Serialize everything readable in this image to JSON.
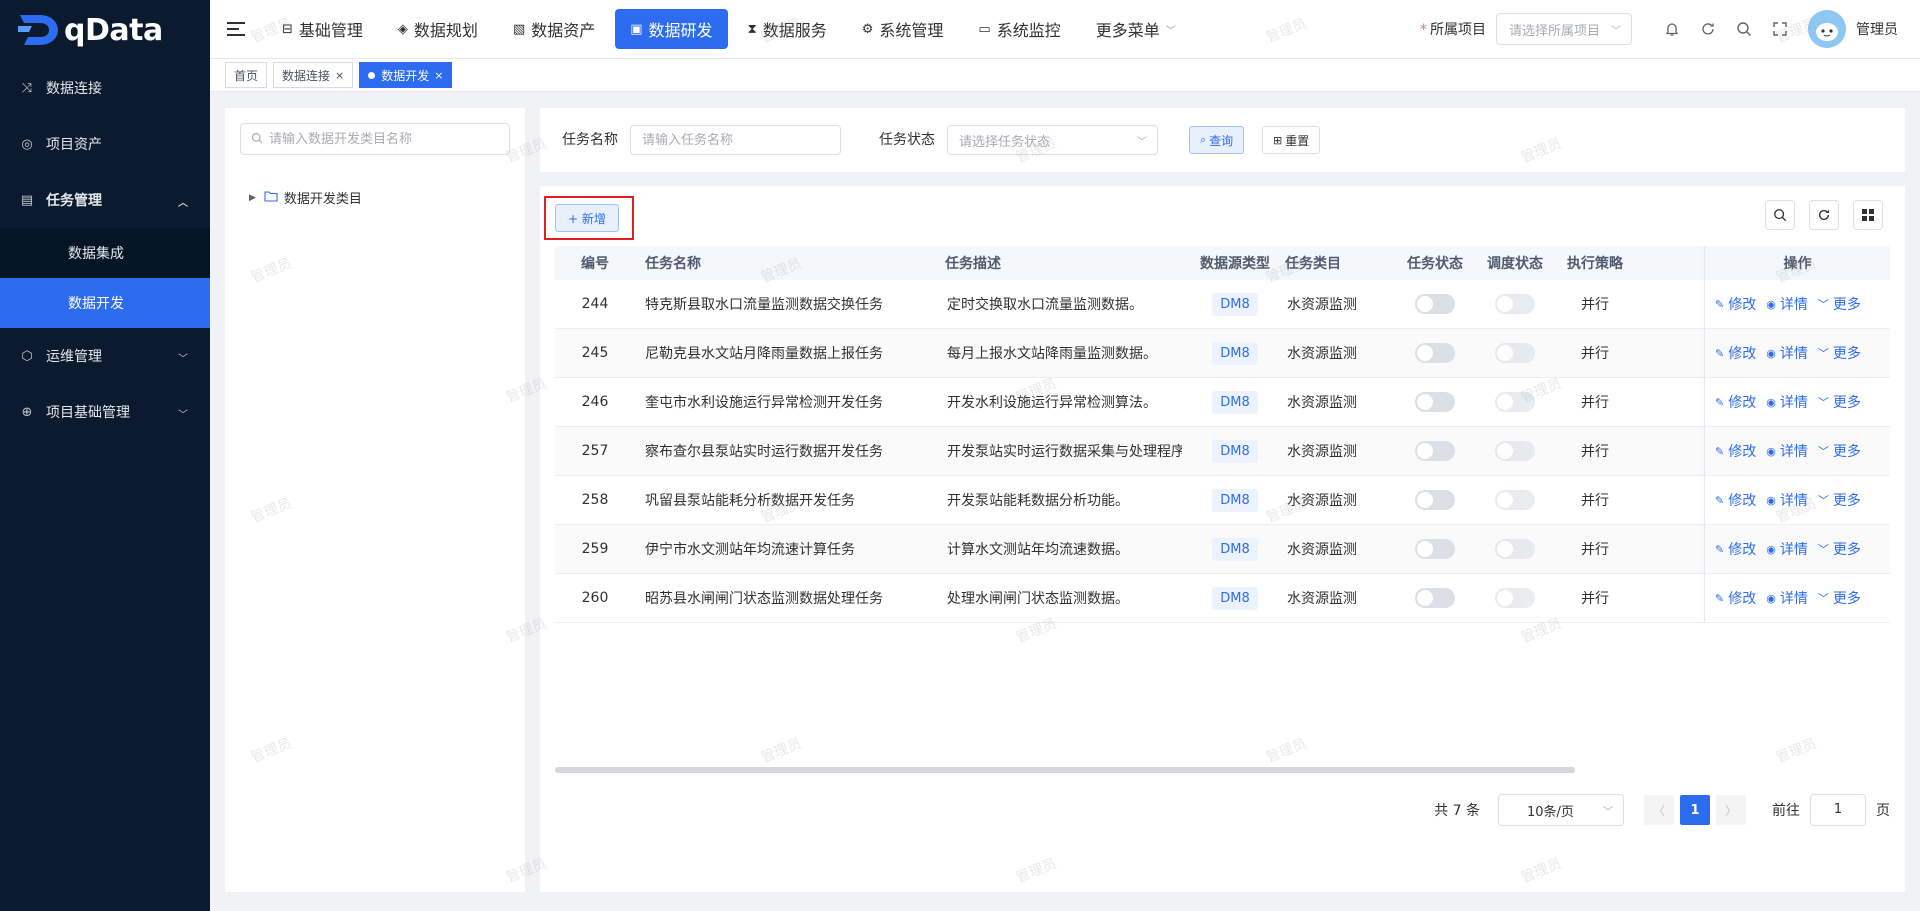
{
  "app": {
    "logo_text": "qData",
    "watermark": "管理员"
  },
  "sidebar": {
    "items": [
      {
        "label": "数据连接",
        "icon": "shuffle-icon"
      },
      {
        "label": "项目资产",
        "icon": "asset-icon"
      },
      {
        "label": "任务管理",
        "icon": "document-icon",
        "expanded": true,
        "children": [
          {
            "label": "数据集成",
            "active": false
          },
          {
            "label": "数据开发",
            "active": true
          }
        ]
      },
      {
        "label": "运维管理",
        "icon": "cube-icon"
      },
      {
        "label": "项目基础管理",
        "icon": "globe-icon"
      }
    ]
  },
  "topnav": {
    "items": [
      {
        "label": "基础管理",
        "icon": "grid-icon"
      },
      {
        "label": "数据规划",
        "icon": "layers-icon"
      },
      {
        "label": "数据资产",
        "icon": "file-icon"
      },
      {
        "label": "数据研发",
        "icon": "window-icon",
        "active": true
      },
      {
        "label": "数据服务",
        "icon": "hourglass-icon"
      },
      {
        "label": "系统管理",
        "icon": "gear-icon"
      },
      {
        "label": "系统监控",
        "icon": "monitor-icon"
      }
    ],
    "more_label": "更多菜单",
    "project_label": "所属项目",
    "project_placeholder": "请选择所属项目",
    "user_name": "管理员"
  },
  "tabs": [
    {
      "label": "首页",
      "closable": false,
      "active": false
    },
    {
      "label": "数据连接",
      "closable": true,
      "active": false
    },
    {
      "label": "数据开发",
      "closable": true,
      "active": true
    }
  ],
  "tree": {
    "search_placeholder": "请输入数据开发类目名称",
    "root_label": "数据开发类目"
  },
  "filters": {
    "task_name_label": "任务名称",
    "task_name_placeholder": "请输入任务名称",
    "task_status_label": "任务状态",
    "task_status_placeholder": "请选择任务状态",
    "query_label": "查询",
    "reset_label": "重置"
  },
  "toolbar": {
    "add_label": "+ 新增"
  },
  "table": {
    "columns": [
      "编号",
      "任务名称",
      "任务描述",
      "数据源类型",
      "任务类目",
      "任务状态",
      "调度状态",
      "执行策略",
      "操作"
    ],
    "rows": [
      {
        "id": "244",
        "name": "特克斯县取水口流量监测数据交换任务",
        "desc": "定时交换取水口流量监测数据。",
        "source": "DM8",
        "category": "水资源监测",
        "task_on": false,
        "sched_on": false,
        "strategy": "并行"
      },
      {
        "id": "245",
        "name": "尼勒克县水文站月降雨量数据上报任务",
        "desc": "每月上报水文站降雨量监测数据。",
        "source": "DM8",
        "category": "水资源监测",
        "task_on": false,
        "sched_on": false,
        "strategy": "并行"
      },
      {
        "id": "246",
        "name": "奎屯市水利设施运行异常检测开发任务",
        "desc": "开发水利设施运行异常检测算法。",
        "source": "DM8",
        "category": "水资源监测",
        "task_on": false,
        "sched_on": false,
        "strategy": "并行"
      },
      {
        "id": "257",
        "name": "察布查尔县泵站实时运行数据开发任务",
        "desc": "开发泵站实时运行数据采集与处理程序。",
        "source": "DM8",
        "category": "水资源监测",
        "task_on": false,
        "sched_on": false,
        "strategy": "并行"
      },
      {
        "id": "258",
        "name": "巩留县泵站能耗分析数据开发任务",
        "desc": "开发泵站能耗数据分析功能。",
        "source": "DM8",
        "category": "水资源监测",
        "task_on": false,
        "sched_on": false,
        "strategy": "并行"
      },
      {
        "id": "259",
        "name": "伊宁市水文测站年均流速计算任务",
        "desc": "计算水文测站年均流速数据。",
        "source": "DM8",
        "category": "水资源监测",
        "task_on": false,
        "sched_on": false,
        "strategy": "并行"
      },
      {
        "id": "260",
        "name": "昭苏县水闸闸门状态监测数据处理任务",
        "desc": "处理水闸闸门状态监测数据。",
        "source": "DM8",
        "category": "水资源监测",
        "task_on": false,
        "sched_on": false,
        "strategy": "并行"
      }
    ],
    "ops": {
      "edit": "修改",
      "detail": "详情",
      "more": "更多"
    }
  },
  "pagination": {
    "total": "共 7 条",
    "page_size": "10条/页",
    "current_page": "1",
    "goto_label": "前往",
    "goto_value": "1",
    "page_unit": "页"
  },
  "colors": {
    "primary": "#2d6cf0",
    "sidebar_bg": "#0b1a2e",
    "highlight_box": "#e02020"
  }
}
